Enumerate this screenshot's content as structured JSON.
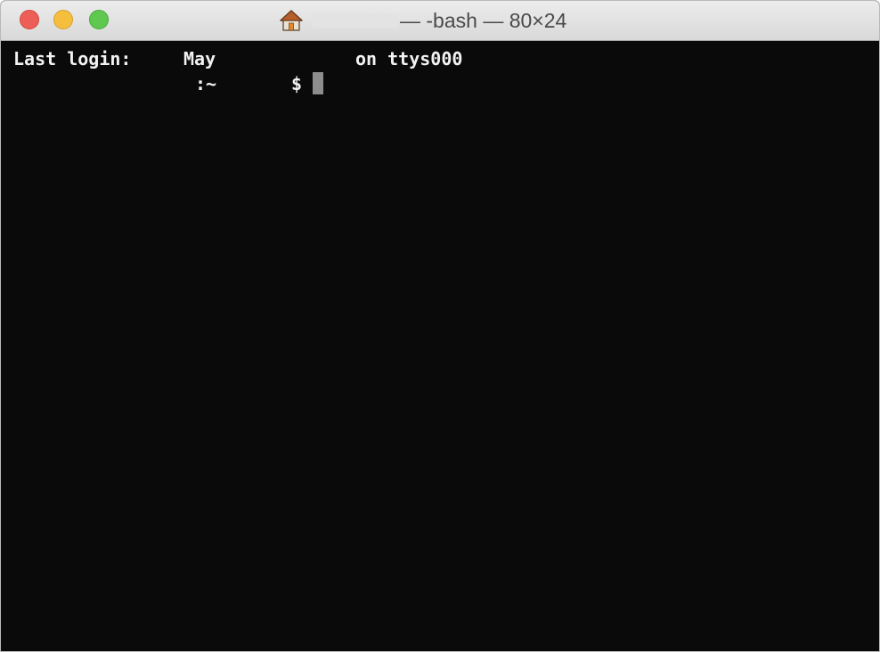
{
  "window": {
    "title": "— -bash — 80×24",
    "title_icon": "home-icon"
  },
  "traffic_lights": {
    "close_color": "#ed5f56",
    "minimize_color": "#f5be3d",
    "zoom_color": "#5fc84f"
  },
  "terminal": {
    "background": "#0a0a0a",
    "login": {
      "label": "Last login:",
      "month": "May",
      "tty": "on ttys000"
    },
    "prompt": {
      "path": ":~",
      "symbol": "$"
    }
  }
}
